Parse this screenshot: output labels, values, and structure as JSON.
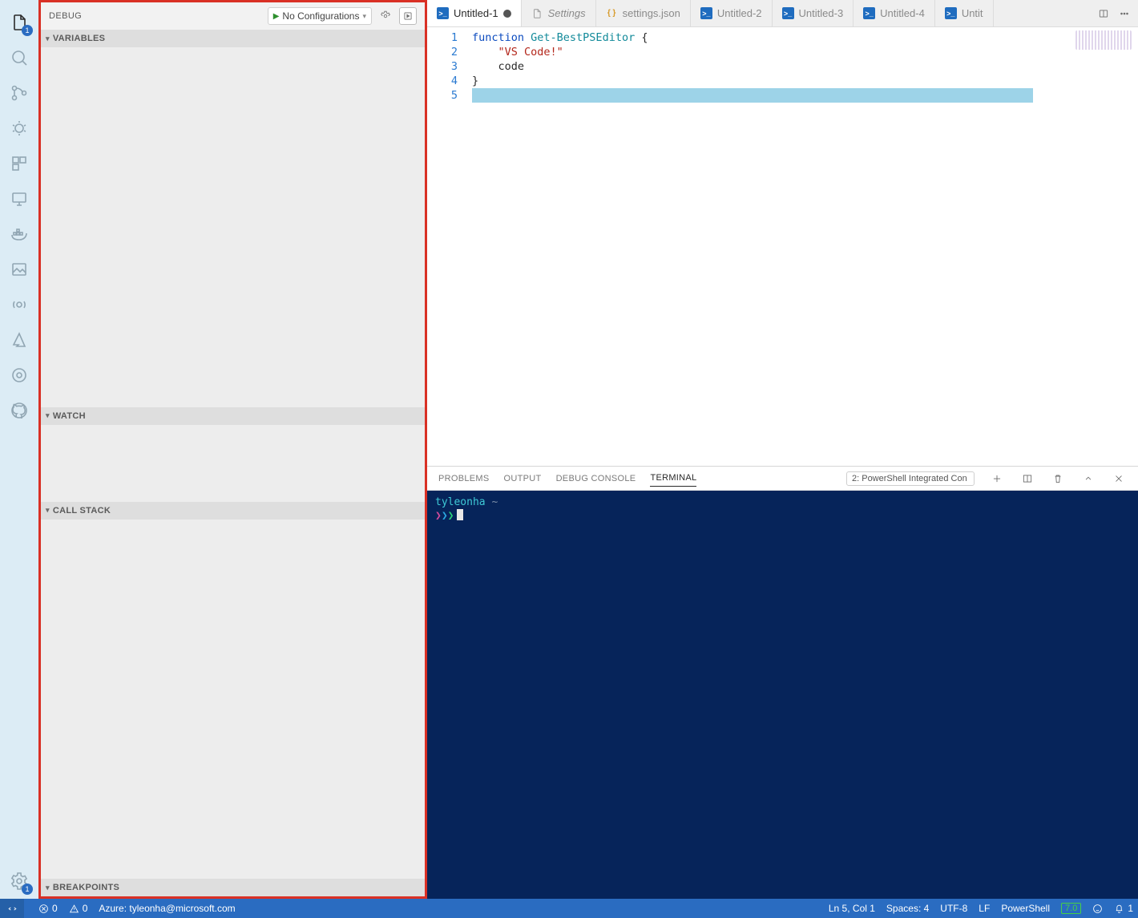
{
  "activityBar": {
    "explorerBadge": "1",
    "settingsBadge": "1"
  },
  "sidebar": {
    "title": "DEBUG",
    "config": "No Configurations",
    "sections": {
      "variables": "VARIABLES",
      "watch": "WATCH",
      "callstack": "CALL STACK",
      "breakpoints": "BREAKPOINTS"
    }
  },
  "tabs": [
    {
      "label": "Untitled-1",
      "icon": "ps",
      "active": true,
      "dirty": true
    },
    {
      "label": "Settings",
      "icon": "file",
      "italic": true
    },
    {
      "label": "settings.json",
      "icon": "json"
    },
    {
      "label": "Untitled-2",
      "icon": "ps"
    },
    {
      "label": "Untitled-3",
      "icon": "ps"
    },
    {
      "label": "Untitled-4",
      "icon": "ps"
    },
    {
      "label": "Untit",
      "icon": "ps"
    }
  ],
  "editor": {
    "lineNumbers": [
      "1",
      "2",
      "3",
      "4",
      "5"
    ],
    "l1_kw": "function",
    "l1_fn": " Get-BestPSEditor ",
    "l1_rest": "{",
    "l2_indent": "    ",
    "l2_str": "\"VS Code!\"",
    "l3": "    code",
    "l4": "}"
  },
  "panel": {
    "tabs": {
      "problems": "PROBLEMS",
      "output": "OUTPUT",
      "debug": "DEBUG CONSOLE",
      "terminal": "TERMINAL"
    },
    "termSelect": "2: PowerShell Integrated Con",
    "prompt": {
      "user": "tyleonha",
      "tilde": "~"
    }
  },
  "status": {
    "errors": "0",
    "warnings": "0",
    "azure": "Azure: tyleonha@microsoft.com",
    "lncol": "Ln 5, Col 1",
    "spaces": "Spaces: 4",
    "encoding": "UTF-8",
    "eol": "LF",
    "lang": "PowerShell",
    "psver": "7.0",
    "bell": "1"
  }
}
